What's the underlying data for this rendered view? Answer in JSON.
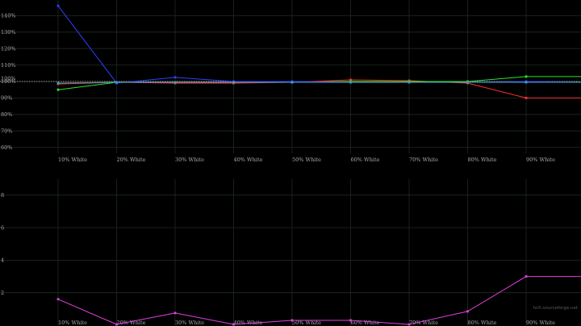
{
  "chart_data": [
    {
      "type": "line",
      "categories": [
        "10% White",
        "20% White",
        "30% White",
        "40% White",
        "50% White",
        "60% White",
        "70% White",
        "80% White",
        "90% White"
      ],
      "ylim": [
        55,
        150
      ],
      "yticks": [
        "140%",
        "130%",
        "120%",
        "110%",
        "100%",
        "90%",
        "80%",
        "70%",
        "60%"
      ],
      "reference": 100,
      "grid": true,
      "series": [
        {
          "color": "#ff3030",
          "values": [
            98.5,
            99.5,
            99.0,
            99.0,
            99.5,
            101.0,
            100.5,
            99.0,
            90.0,
            90.0
          ]
        },
        {
          "color": "#30e030",
          "values": [
            95.0,
            99.5,
            99.5,
            99.5,
            99.5,
            100.0,
            100.0,
            100.0,
            103.0,
            103.0
          ]
        },
        {
          "color": "#3040ff",
          "values": [
            146.0,
            99.0,
            102.5,
            100.0,
            100.0,
            99.5,
            99.5,
            99.5,
            100.0,
            99.5
          ]
        },
        {
          "color": "#40a0c0",
          "values": [
            99.0,
            99.5,
            99.5,
            99.5,
            99.5,
            99.5,
            99.5,
            99.5,
            99.5,
            99.5
          ]
        }
      ]
    },
    {
      "type": "line",
      "categories": [
        "10% White",
        "20% White",
        "30% White",
        "40% White",
        "50% White",
        "60% White",
        "70% White",
        "80% White",
        "90% White"
      ],
      "ylim": [
        0,
        9
      ],
      "yticks": [
        "8",
        "6",
        "4",
        "2"
      ],
      "grid": true,
      "series": [
        {
          "color": "#e040e0",
          "values": [
            1.6,
            0.05,
            0.75,
            0.05,
            0.3,
            0.3,
            0.05,
            0.85,
            3.0,
            3.0
          ]
        }
      ]
    }
  ],
  "watermark": "hcfr.sourceforge.net"
}
